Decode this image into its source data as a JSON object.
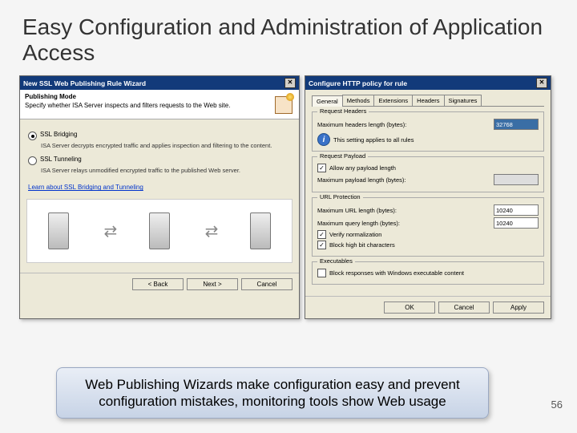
{
  "slide": {
    "title": "Easy Configuration and Administration of Application Access",
    "page_number": "56"
  },
  "caption": "Web Publishing Wizards make configuration easy and prevent configuration mistakes, monitoring tools show Web usage",
  "wizard": {
    "title": "New SSL Web Publishing Rule Wizard",
    "heading": "Publishing Mode",
    "subheading": "Specify whether ISA Server inspects and filters requests to the Web site.",
    "opt1": {
      "label": "SSL Bridging",
      "desc": "ISA Server decrypts encrypted traffic and applies inspection and filtering to the content."
    },
    "opt2": {
      "label": "SSL Tunneling",
      "desc": "ISA Server relays unmodified encrypted traffic to the published Web server."
    },
    "link": "Learn about SSL Bridging and Tunneling",
    "buttons": {
      "back": "< Back",
      "next": "Next >",
      "cancel": "Cancel"
    }
  },
  "http": {
    "title": "Configure HTTP policy for rule",
    "tabs": [
      "General",
      "Methods",
      "Extensions",
      "Headers",
      "Signatures"
    ],
    "request_headers": {
      "title": "Request Headers",
      "max_headers_label": "Maximum headers length (bytes):",
      "max_headers_value": "32768",
      "note": "This setting applies to all rules"
    },
    "request_payload": {
      "title": "Request Payload",
      "allow_any": "Allow any payload length",
      "max_payload_label": "Maximum payload length (bytes):",
      "max_payload_value": ""
    },
    "url_protection": {
      "title": "URL Protection",
      "max_url_label": "Maximum URL length (bytes):",
      "max_url_value": "10240",
      "max_query_label": "Maximum query length (bytes):",
      "max_query_value": "10240",
      "verify": "Verify normalization",
      "block_high": "Block high bit characters"
    },
    "executables": {
      "title": "Executables",
      "block_exec": "Block responses with Windows executable content"
    },
    "buttons": {
      "ok": "OK",
      "cancel": "Cancel",
      "apply": "Apply"
    }
  }
}
